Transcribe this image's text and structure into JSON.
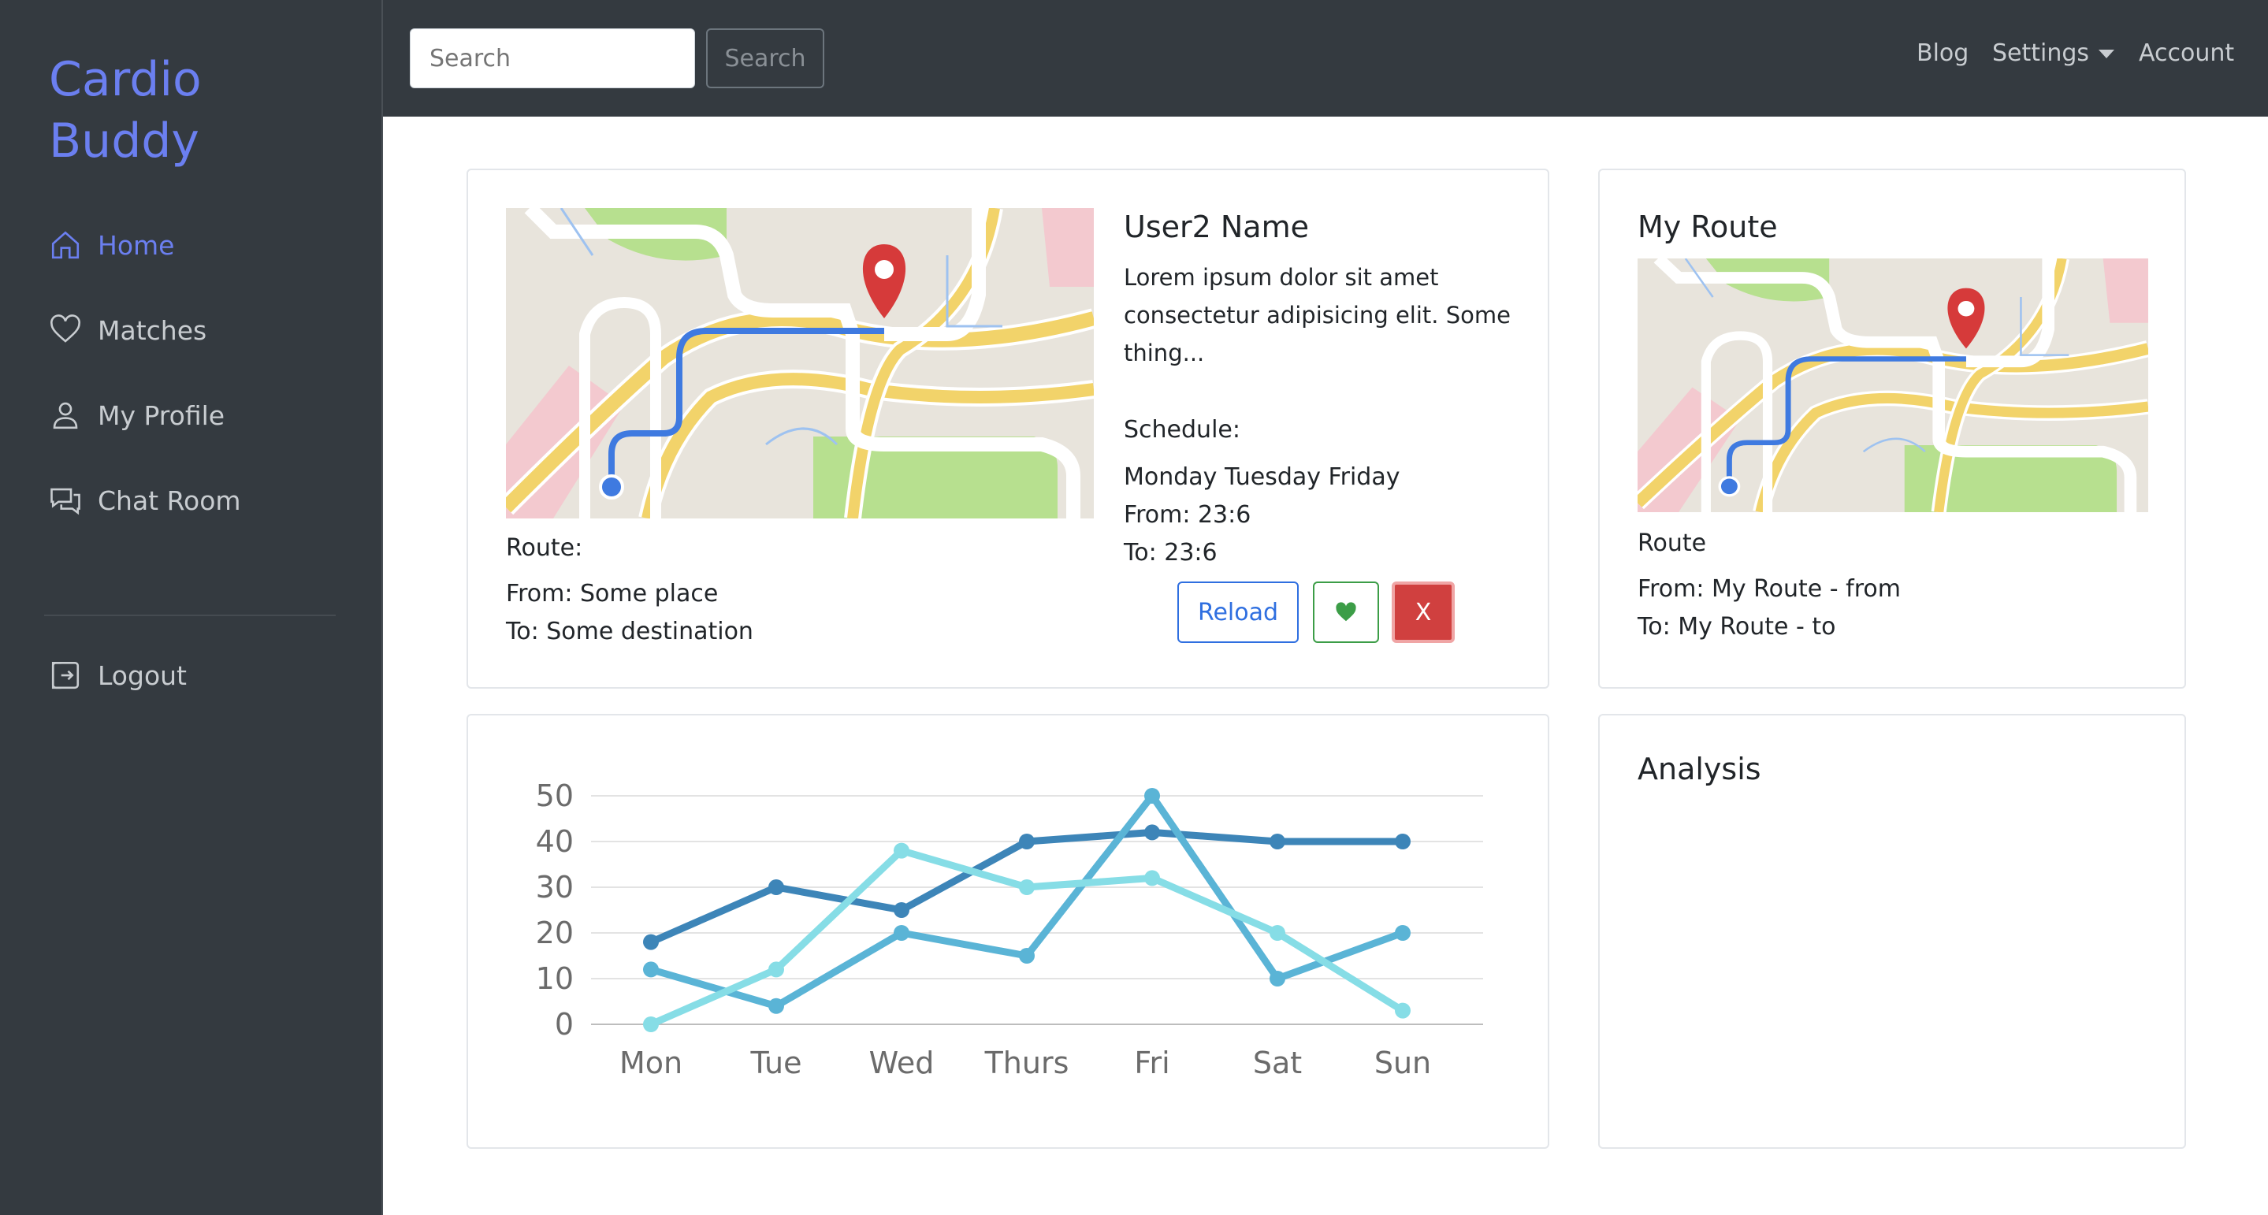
{
  "sidebar": {
    "brand_line1": "Cardio",
    "brand_line2": "Buddy",
    "items": [
      {
        "label": "Home",
        "icon": "home-icon",
        "active": true
      },
      {
        "label": "Matches",
        "icon": "heart-icon",
        "active": false
      },
      {
        "label": "My Profile",
        "icon": "person-icon",
        "active": false
      },
      {
        "label": "Chat Room",
        "icon": "chat-icon",
        "active": false
      }
    ],
    "logout_label": "Logout"
  },
  "topbar": {
    "search_placeholder": "Search",
    "search_button": "Search",
    "links": {
      "blog": "Blog",
      "settings": "Settings",
      "account": "Account"
    }
  },
  "match_card": {
    "name": "User2 Name",
    "description": "Lorem ipsum dolor sit amet consectetur adipisicing elit. Some thing...",
    "schedule_label": "Schedule:",
    "schedule_days": "Monday Tuesday Friday",
    "from_time": "From: 23:6",
    "to_time": "To: 23:6",
    "route_label": "Route:",
    "route_from": "From: Some place",
    "route_to": "To: Some destination",
    "reload_label": "Reload",
    "like_icon": "heart-icon",
    "dismiss_label": "X"
  },
  "my_route": {
    "title": "My Route",
    "route_label": "Route",
    "from": "From: My Route - from",
    "to": "To: My Route - to"
  },
  "analysis": {
    "title": "Analysis"
  },
  "colors": {
    "sidebar_bg": "#343a40",
    "accent": "#6b7ff0",
    "primary": "#2f6fe0",
    "success": "#3c9d47",
    "danger": "#d0403f"
  },
  "chart_data": {
    "type": "line",
    "categories": [
      "Mon",
      "Tue",
      "Wed",
      "Thurs",
      "Fri",
      "Sat",
      "Sun"
    ],
    "y_ticks": [
      0,
      10,
      20,
      30,
      40,
      50
    ],
    "ylim": [
      0,
      50
    ],
    "grid": true,
    "series": [
      {
        "values": [
          18,
          30,
          25,
          40,
          42,
          40,
          40
        ],
        "color": "#3d85b8"
      },
      {
        "values": [
          12,
          4,
          20,
          15,
          50,
          10,
          20
        ],
        "color": "#5ab4d6"
      },
      {
        "values": [
          0,
          12,
          38,
          30,
          32,
          20,
          3
        ],
        "color": "#86dde6"
      }
    ]
  }
}
